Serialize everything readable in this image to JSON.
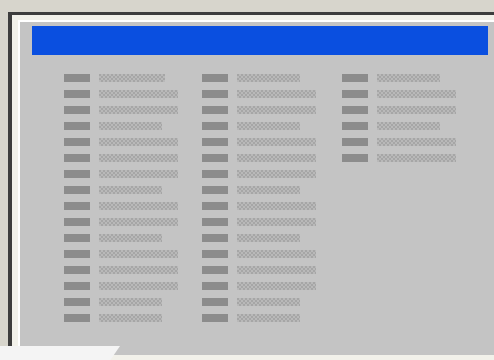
{
  "window": {
    "title": ""
  },
  "colors": {
    "title_bar": "#0a4fe0",
    "dialog_bg": "#c4c4c4",
    "field_key": "#8c8c8c"
  },
  "columns": [
    {
      "rows": [
        66,
        79,
        79,
        63,
        79,
        79,
        79,
        63,
        79,
        79,
        63,
        79,
        79,
        79,
        63,
        63
      ]
    },
    {
      "rows": [
        63,
        79,
        79,
        63,
        79,
        79,
        79,
        63,
        79,
        79,
        63,
        79,
        79,
        79,
        63,
        63
      ]
    },
    {
      "rows": [
        63,
        79,
        79,
        63,
        79,
        79
      ]
    }
  ]
}
